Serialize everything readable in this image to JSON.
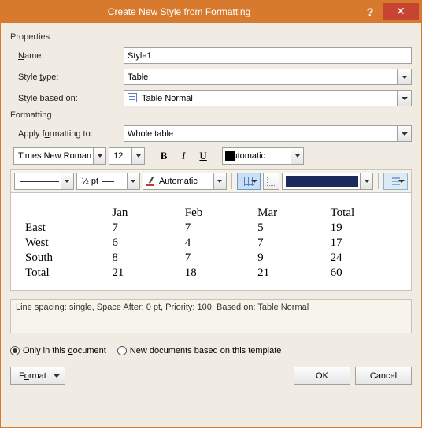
{
  "titlebar": {
    "title": "Create New Style from Formatting",
    "help": "?",
    "close": "✕"
  },
  "sections": {
    "properties": "Properties",
    "formatting": "Formatting"
  },
  "labels": {
    "name_pre": "",
    "name_u": "N",
    "name_post": "ame:",
    "styletype_pre": "Style ",
    "styletype_u": "t",
    "styletype_post": "ype:",
    "basedon_pre": "Style ",
    "basedon_u": "b",
    "basedon_post": "ased on:",
    "applyto_pre": "Apply f",
    "applyto_u": "o",
    "applyto_post": "rmatting to:"
  },
  "values": {
    "name": "Style1",
    "style_type": "Table",
    "based_on": "Table Normal",
    "apply_to": "Whole table",
    "font": "Times New Roman",
    "font_size": "12",
    "font_color": "Automatic",
    "line_weight": "½ pt",
    "pen_color": "Automatic"
  },
  "buttons": {
    "bold": "B",
    "italic": "I",
    "underline": "U",
    "format_pre": "F",
    "format_u": "o",
    "format_post": "rmat",
    "ok": "OK",
    "cancel": "Cancel"
  },
  "radios": {
    "only_pre": "Only in this ",
    "only_u": "d",
    "only_post": "ocument",
    "newdocs": "New documents based on this template"
  },
  "description": "Line spacing:  single, Space After:  0 pt, Priority: 100, Based on: Table Normal",
  "chart_data": {
    "type": "table",
    "columns": [
      "",
      "Jan",
      "Feb",
      "Mar",
      "Total"
    ],
    "rows": [
      [
        "East",
        "7",
        "7",
        "5",
        "19"
      ],
      [
        "West",
        "6",
        "4",
        "7",
        "17"
      ],
      [
        "South",
        "8",
        "7",
        "9",
        "24"
      ],
      [
        "Total",
        "21",
        "18",
        "21",
        "60"
      ]
    ]
  }
}
